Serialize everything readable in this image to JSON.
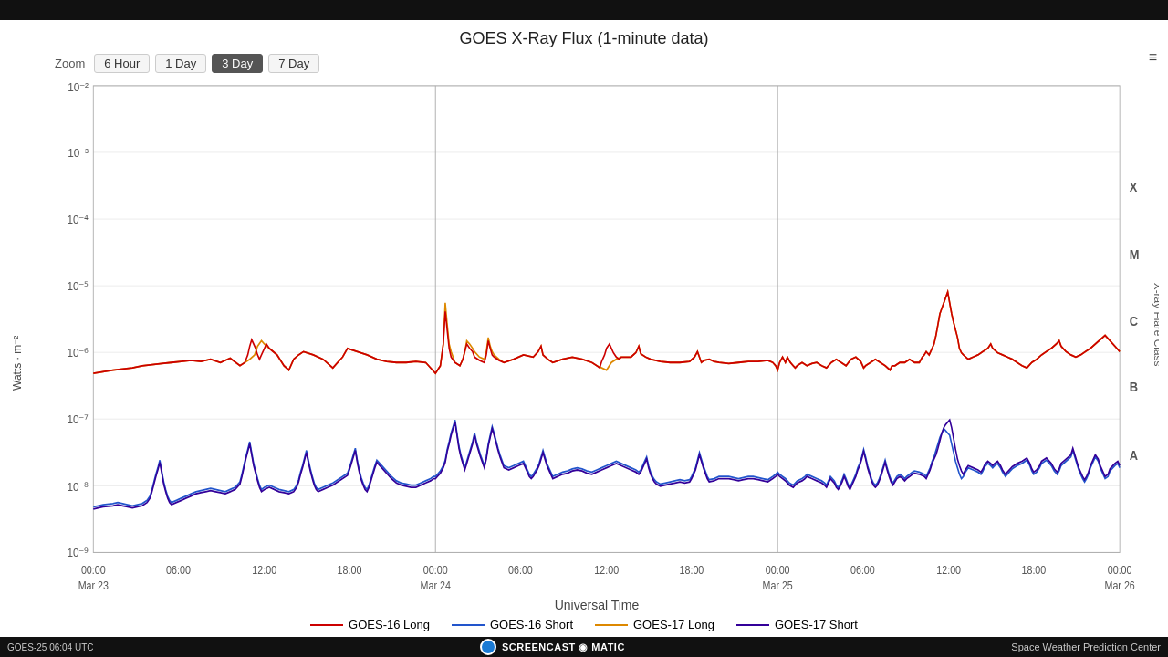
{
  "topBar": {},
  "title": "GOES X-Ray Flux (1-minute data)",
  "menuIcon": "≡",
  "zoom": {
    "label": "Zoom",
    "buttons": [
      {
        "label": "6 Hour",
        "active": false
      },
      {
        "label": "1 Day",
        "active": false
      },
      {
        "label": "3 Day",
        "active": true
      },
      {
        "label": "7 Day",
        "active": false
      }
    ]
  },
  "yAxisLabel": "Watts · m⁻²",
  "yAxisTicks": [
    "10⁻²",
    "10⁻³",
    "10⁻⁴",
    "10⁻⁵",
    "10⁻⁶",
    "10⁻⁷",
    "10⁻⁸",
    "10⁻⁹"
  ],
  "xAxisLabels": [
    {
      "time": "00:00",
      "date": "Mar 23"
    },
    {
      "time": "06:00",
      "date": ""
    },
    {
      "time": "12:00",
      "date": ""
    },
    {
      "time": "18:00",
      "date": ""
    },
    {
      "time": "00:00",
      "date": "Mar 24"
    },
    {
      "time": "06:00",
      "date": ""
    },
    {
      "time": "12:00",
      "date": ""
    },
    {
      "time": "18:00",
      "date": ""
    },
    {
      "time": "00:00",
      "date": "Mar 25"
    },
    {
      "time": "06:00",
      "date": ""
    },
    {
      "time": "12:00",
      "date": ""
    },
    {
      "time": "18:00",
      "date": ""
    },
    {
      "time": "00:00",
      "date": "Mar 26"
    }
  ],
  "xAxisMainLabel": "Universal Time",
  "flareClasses": [
    "X",
    "M",
    "C",
    "B",
    "A"
  ],
  "flareClassLabel": "X-ray Flare Class",
  "legend": [
    {
      "label": "GOES-16 Long",
      "color": "#cc0000"
    },
    {
      "label": "GOES-16 Short",
      "color": "#2255cc"
    },
    {
      "label": "GOES-17 Long",
      "color": "#dd8800"
    },
    {
      "label": "GOES-17 Short",
      "color": "#220088"
    }
  ],
  "bottomLeft": "GOES-25 06:04 UTC",
  "bottomRight": "Space Weather Prediction Center",
  "screencastLabel": "SCREENCAST   MATIC"
}
